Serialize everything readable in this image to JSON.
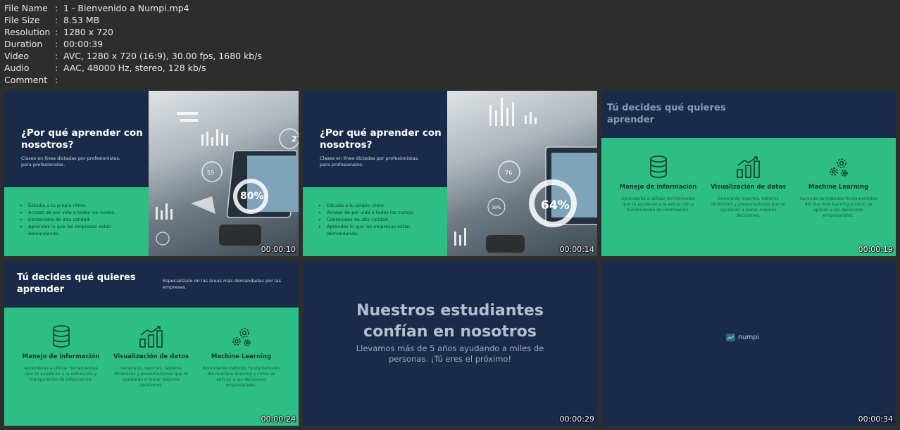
{
  "meta": [
    {
      "key": "File Name",
      "value": "1 - Bienvenido a Numpi.mp4"
    },
    {
      "key": "File Size",
      "value": "8.53 MB"
    },
    {
      "key": "Resolution",
      "value": "1280 x 720"
    },
    {
      "key": "Duration",
      "value": "00:00:39"
    },
    {
      "key": "Video",
      "value": "AVC, 1280 x 720 (16:9), 30.00 fps, 1680 kb/s"
    },
    {
      "key": "Audio",
      "value": "AAC, 48000 Hz, stereo, 128 kb/s"
    },
    {
      "key": "Comment",
      "value": ""
    }
  ],
  "separator": ":",
  "colors": {
    "navy": "#1a2b4a",
    "green": "#2dbe86",
    "background": "#2d2d2d"
  },
  "why": {
    "title_l1": "¿Por qué aprender con",
    "title_l2": "nosotros?",
    "sub_l1": "Clases en línea dictadas por profesionistas,",
    "sub_l2": "para profesionales.",
    "bullets": [
      "Estudia a tu propio ritmo.",
      "Acceso de por vida a todos los cursos.",
      "Contenidos de alta calidad.",
      "Aprendes lo que las empresas están",
      "demandando."
    ]
  },
  "decide": {
    "title_l1": "Tú decides qué quieres",
    "title_l2": "aprender",
    "side_l1": "Especialízate en las áreas más demandadas por las",
    "side_l2": "empresas.",
    "cols": [
      {
        "icon": "database-icon",
        "title": "Manejo de información",
        "desc": [
          "Aprenderás a utilizar herramientas",
          "que te ayudarán a la extracción y",
          "manipulación de información."
        ]
      },
      {
        "icon": "bar-chart-icon",
        "title": "Visualización de datos",
        "desc": [
          "Generarás reportes, tableros",
          "dinámicos y presentaciones que te",
          "ayudarán a tomar mejores",
          "decisiones."
        ]
      },
      {
        "icon": "gears-icon",
        "title": "Machine Learning",
        "desc": [
          "Aprenderás métodos fundamentales",
          "del machine learning y cómo se",
          "aplican a las decisiones",
          "empresariales."
        ]
      }
    ]
  },
  "photo_labels": {
    "t1": {
      "a": "80%",
      "b": "55",
      "c": "27"
    },
    "t2": {
      "a": "64%",
      "b": "76",
      "c": "39%"
    }
  },
  "students": {
    "title_l1": "Nuestros estudiantes",
    "title_l2": "confían en nosotros",
    "sub_l1": "Llevamos más de 5 años ayudando a miles de",
    "sub_l2": "personas. ¡Tú eres el próximo!"
  },
  "logo": {
    "text": "numpi"
  },
  "timestamps": [
    "00:00:10",
    "00:00:14",
    "00:00:19",
    "00:00:24",
    "00:00:29",
    "00:00:34"
  ]
}
